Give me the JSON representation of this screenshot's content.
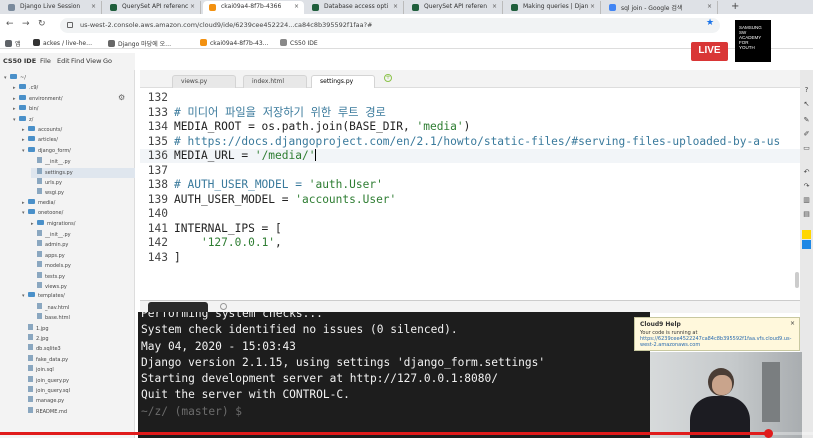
{
  "browser": {
    "tabs": [
      {
        "title": "Django Live Session",
        "color": "#7a8a9c"
      },
      {
        "title": "QuerySet API referenc",
        "color": "#1f5e3c"
      },
      {
        "title": "ckai09a4-8f7b-4366",
        "color": "#f29111",
        "active": true
      },
      {
        "title": "Database access opti",
        "color": "#1f5e3c"
      },
      {
        "title": "QuerySet API referen",
        "color": "#1f5e3c"
      },
      {
        "title": "Making queries | Djan",
        "color": "#1f5e3c"
      },
      {
        "title": "sql join - Google 검색",
        "color": "#4285f4"
      }
    ],
    "new_tab": "+",
    "url": "us-west-2.console.aws.amazon.com/cloud9/ide/6239cee452224...ca84c8b395592f1faa?#",
    "bookmarks": [
      {
        "label": "앱",
        "color": "#5f6368"
      },
      {
        "label": "ackes / live-he…",
        "color": "#333"
      },
      {
        "label": "Django 마당에 오…",
        "color": "#666"
      },
      {
        "label": "ckai09a4-8f7b-43…",
        "color": "#f29111"
      },
      {
        "label": "CS50 IDE",
        "color": "#888"
      }
    ]
  },
  "overlay": {
    "live": "LIVE",
    "logo_lines": [
      "SAMSUNG",
      "SW",
      "ACADEMY",
      "FOR",
      "YOUTH"
    ]
  },
  "ide": {
    "name": "CS50 IDE",
    "menu": [
      "File",
      "Edit",
      "Find",
      "View",
      "Go"
    ],
    "tree": [
      {
        "label": "~/",
        "depth": 0,
        "type": "folder",
        "open": true
      },
      {
        "label": ".c9/",
        "depth": 1,
        "type": "folder"
      },
      {
        "label": "environment/",
        "depth": 1,
        "type": "folder"
      },
      {
        "label": "bin/",
        "depth": 1,
        "type": "folder"
      },
      {
        "label": "z/",
        "depth": 1,
        "type": "folder",
        "open": true
      },
      {
        "label": "accounts/",
        "depth": 2,
        "type": "folder"
      },
      {
        "label": "articles/",
        "depth": 2,
        "type": "folder"
      },
      {
        "label": "django_form/",
        "depth": 2,
        "type": "folder",
        "open": true
      },
      {
        "label": "__init__.py",
        "depth": 3,
        "type": "file"
      },
      {
        "label": "settings.py",
        "depth": 3,
        "type": "file",
        "selected": true
      },
      {
        "label": "urls.py",
        "depth": 3,
        "type": "file"
      },
      {
        "label": "wsgi.py",
        "depth": 3,
        "type": "file"
      },
      {
        "label": "media/",
        "depth": 2,
        "type": "folder"
      },
      {
        "label": "onetoone/",
        "depth": 2,
        "type": "folder",
        "open": true
      },
      {
        "label": "migrations/",
        "depth": 3,
        "type": "folder"
      },
      {
        "label": "__init__.py",
        "depth": 3,
        "type": "file"
      },
      {
        "label": "admin.py",
        "depth": 3,
        "type": "file"
      },
      {
        "label": "apps.py",
        "depth": 3,
        "type": "file"
      },
      {
        "label": "models.py",
        "depth": 3,
        "type": "file"
      },
      {
        "label": "tests.py",
        "depth": 3,
        "type": "file"
      },
      {
        "label": "views.py",
        "depth": 3,
        "type": "file"
      },
      {
        "label": "templates/",
        "depth": 2,
        "type": "folder",
        "open": true
      },
      {
        "label": "_nav.html",
        "depth": 3,
        "type": "file"
      },
      {
        "label": "base.html",
        "depth": 3,
        "type": "file"
      },
      {
        "label": "1.jpg",
        "depth": 2,
        "type": "file"
      },
      {
        "label": "2.jpg",
        "depth": 2,
        "type": "file"
      },
      {
        "label": "db.sqlite3",
        "depth": 2,
        "type": "file"
      },
      {
        "label": "fake_data.py",
        "depth": 2,
        "type": "file"
      },
      {
        "label": "join.sql",
        "depth": 2,
        "type": "file"
      },
      {
        "label": "join_query.py",
        "depth": 2,
        "type": "file"
      },
      {
        "label": "join_query.sql",
        "depth": 2,
        "type": "file"
      },
      {
        "label": "manage.py",
        "depth": 2,
        "type": "file"
      },
      {
        "label": "README.md",
        "depth": 2,
        "type": "file"
      }
    ],
    "editor_tabs": [
      {
        "label": "views.py"
      },
      {
        "label": "index.html"
      },
      {
        "label": "settings.py",
        "active": true
      }
    ],
    "code_lines": [
      {
        "n": "132",
        "parts": [
          {
            "t": "",
            "c": "op"
          }
        ]
      },
      {
        "n": "133",
        "parts": [
          {
            "t": "# 미디어 파일을 저장하기 위한 루트 경로",
            "c": "cm"
          }
        ]
      },
      {
        "n": "134",
        "parts": [
          {
            "t": "MEDIA_ROOT = os.path.join(BASE_DIR, ",
            "c": "op"
          },
          {
            "t": "'media'",
            "c": "str"
          },
          {
            "t": ")",
            "c": "op"
          }
        ]
      },
      {
        "n": "135",
        "parts": [
          {
            "t": "# https://docs.djangoproject.com/en/2.1/howto/static-files/#serving-files-uploaded-by-a-us",
            "c": "cm"
          }
        ]
      },
      {
        "n": "136",
        "parts": [
          {
            "t": "MEDIA_URL = ",
            "c": "op"
          },
          {
            "t": "'/media/'",
            "c": "str"
          }
        ],
        "active": true
      },
      {
        "n": "137",
        "parts": [
          {
            "t": "",
            "c": "op"
          }
        ]
      },
      {
        "n": "138",
        "parts": [
          {
            "t": "# AUTH_USER_MODEL = ",
            "c": "cm"
          },
          {
            "t": "'auth.User'",
            "c": "str"
          }
        ]
      },
      {
        "n": "139",
        "parts": [
          {
            "t": "AUTH_USER_MODEL = ",
            "c": "op"
          },
          {
            "t": "'accounts.User'",
            "c": "str"
          }
        ]
      },
      {
        "n": "140",
        "parts": [
          {
            "t": "",
            "c": "op"
          }
        ]
      },
      {
        "n": "141",
        "parts": [
          {
            "t": "INTERNAL_IPS = [",
            "c": "op"
          }
        ]
      },
      {
        "n": "142",
        "parts": [
          {
            "t": "    ",
            "c": "op"
          },
          {
            "t": "'127.0.0.1'",
            "c": "str"
          },
          {
            "t": ",",
            "c": "op"
          }
        ]
      },
      {
        "n": "143",
        "parts": [
          {
            "t": "]",
            "c": "op"
          }
        ]
      }
    ],
    "terminal_lines": [
      "Performing system checks...",
      "",
      "System check identified no issues (0 silenced).",
      "May 04, 2020 - 15:03:43",
      "Django version 2.1.15, using settings 'django_form.settings'",
      "Starting development server at http://127.0.0.1:8080/",
      "Quit the server with CONTROL-C.",
      "~/z/ (master) $ "
    ],
    "help_popup": {
      "title": "Cloud9 Help",
      "text": "Your code is running at",
      "link": "https://6239cee4522247ca84c8b395592f1faa.vfs.cloud9.us-west-2.amazonaws.com",
      "close": "×"
    }
  },
  "video": {
    "progress": 0.945
  }
}
